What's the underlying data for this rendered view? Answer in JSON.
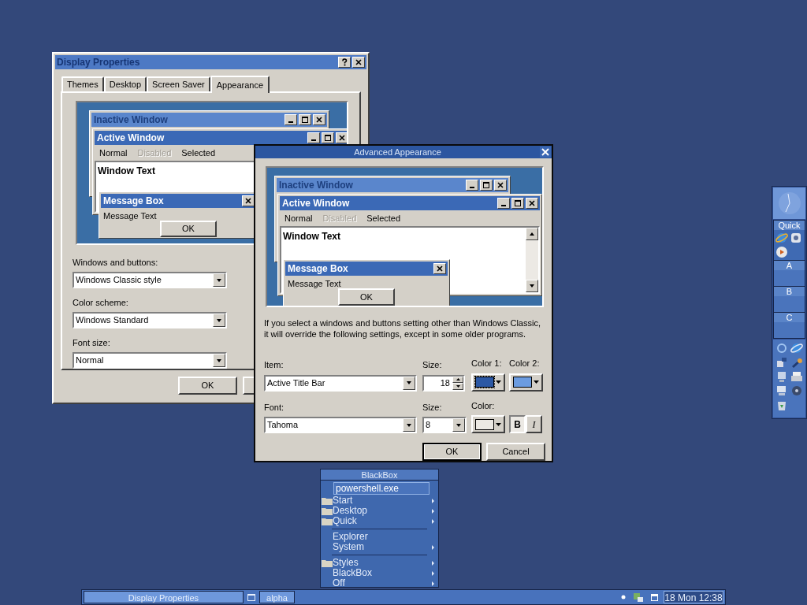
{
  "display_properties": {
    "title": "Display Properties",
    "tabs": [
      {
        "label": "Themes",
        "selected": false
      },
      {
        "label": "Desktop",
        "selected": false
      },
      {
        "label": "Screen Saver",
        "selected": false
      },
      {
        "label": "Appearance",
        "selected": true
      }
    ],
    "preview": {
      "inactive_title": "Inactive Window",
      "active_title": "Active Window",
      "menu": [
        {
          "label": "Normal",
          "disabled": false
        },
        {
          "label": "Disabled",
          "disabled": true
        },
        {
          "label": "Selected",
          "disabled": false
        }
      ],
      "window_text": "Window Text",
      "message_title": "Message Box",
      "message_text": "Message Text",
      "ok": "OK"
    },
    "fields": [
      {
        "label": "Windows and buttons:",
        "value": "Windows Classic style"
      },
      {
        "label": "Color scheme:",
        "value": "Windows Standard"
      },
      {
        "label": "Font size:",
        "value": "Normal"
      }
    ],
    "buttons": [
      "OK"
    ]
  },
  "advanced_appearance": {
    "title": "Advanced Appearance",
    "preview": {
      "inactive_title": "Inactive Window",
      "active_title": "Active Window",
      "menu": [
        {
          "label": "Normal",
          "disabled": false
        },
        {
          "label": "Disabled",
          "disabled": true
        },
        {
          "label": "Selected",
          "disabled": false
        }
      ],
      "window_text": "Window Text",
      "message_title": "Message Box",
      "message_text": "Message Text",
      "ok": "OK"
    },
    "note_lines": [
      "If you select a windows and buttons setting other than Windows Classic,",
      "it will override the following settings, except in some older programs."
    ],
    "item": {
      "label": "Item:",
      "value": "Active Title Bar"
    },
    "item_size": {
      "label": "Size:",
      "value": "18"
    },
    "color_1": {
      "label": "Color 1:",
      "color": "#2c58a4"
    },
    "color_2": {
      "label": "Color 2:",
      "color": "#6c9ce0"
    },
    "font": {
      "label": "Font:",
      "value": "Tahoma"
    },
    "font_size": {
      "label": "Size:",
      "value": "8"
    },
    "font_color": {
      "label": "Color:",
      "color": "#ece9e4"
    },
    "bold": {
      "text": "B",
      "on": true
    },
    "italic": {
      "text": "I",
      "on": false
    },
    "buttons": [
      "OK",
      "Cancel"
    ]
  },
  "slit": {
    "quick_label": "Quick",
    "sections": [
      "A",
      "B",
      "C"
    ]
  },
  "blackbox_menu": {
    "title": "BlackBox",
    "command": "powershell.exe",
    "groups": [
      [
        {
          "label": "Start",
          "folder": true,
          "submenu": true
        },
        {
          "label": "Desktop",
          "folder": true,
          "submenu": true
        },
        {
          "label": "Quick",
          "folder": true,
          "submenu": true
        }
      ],
      [
        {
          "label": "Explorer",
          "folder": false,
          "submenu": false
        },
        {
          "label": "System",
          "folder": false,
          "submenu": true
        }
      ],
      [
        {
          "label": "Styles",
          "folder": true,
          "submenu": true
        },
        {
          "label": "BlackBox",
          "folder": false,
          "submenu": true
        },
        {
          "label": "Off",
          "folder": false,
          "submenu": true
        }
      ]
    ]
  },
  "taskbar": {
    "tasks": [
      {
        "label": "Display Properties",
        "selected": true
      }
    ],
    "workspace": "alpha",
    "clock": "18 Mon 12:38"
  }
}
